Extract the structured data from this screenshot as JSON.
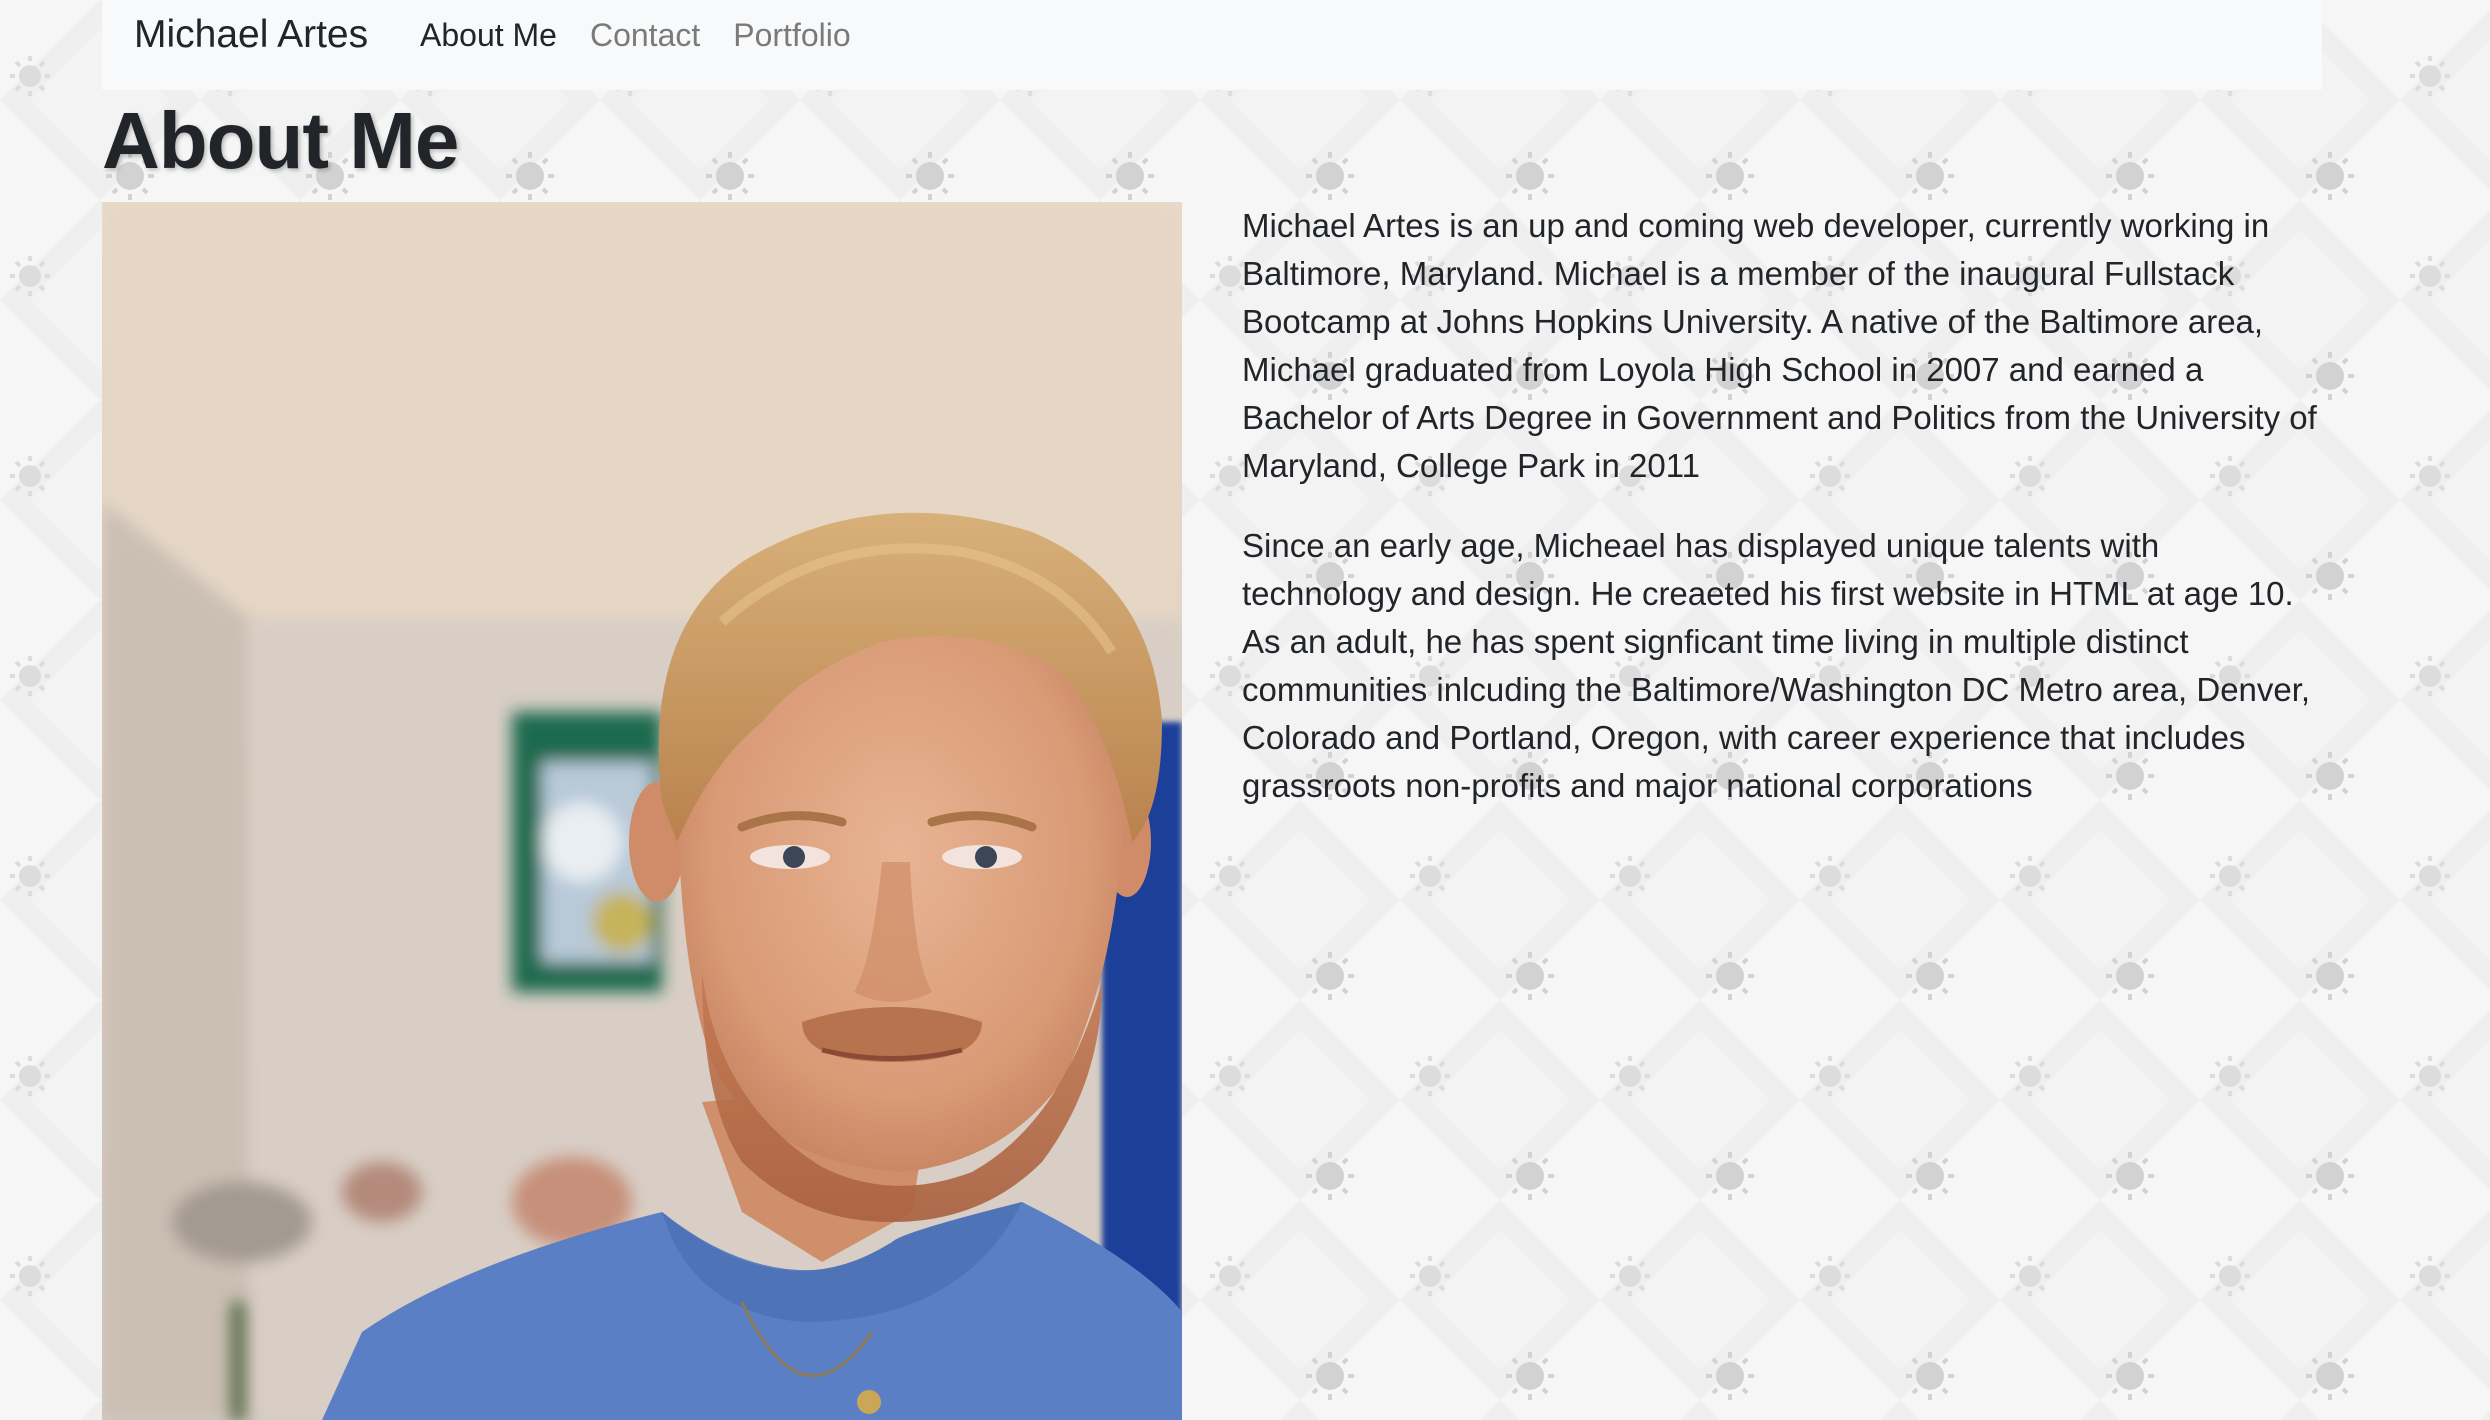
{
  "navbar": {
    "brand": "Michael Artes",
    "links": [
      {
        "label": "About Me",
        "active": true
      },
      {
        "label": "Contact",
        "active": false
      },
      {
        "label": "Portfolio",
        "active": false
      }
    ]
  },
  "main": {
    "title": "About Me",
    "photo_alt": "portrait-photo",
    "paragraphs": [
      "Michael Artes is an up and coming web developer, currently working in Baltimore, Maryland. Michael is a member of the inaugural Fullstack Bootcamp at Johns Hopkins University. A native of the Baltimore area, Michael graduated from Loyola High School in 2007 and earned a Bachelor of Arts Degree in Government and Politics from the University of Maryland, College Park in 2011",
      "Since an early age, Micheael has displayed unique talents with technology and design. He creaeted his first website in HTML at age 10. As an adult, he has spent signficant time living in multiple distinct communities inlcuding the Baltimore/Washington DC Metro area, Denver, Colorado and Portland, Oregon, with career experience that includes grassroots non-profits and major national corporations"
    ]
  },
  "colors": {
    "navbar_bg": "#f8f9fa",
    "text": "#212529",
    "link_inactive": "#7a7a7a",
    "page_bg": "#f4f4f4",
    "shirt_blue": "#5a7fc4"
  }
}
